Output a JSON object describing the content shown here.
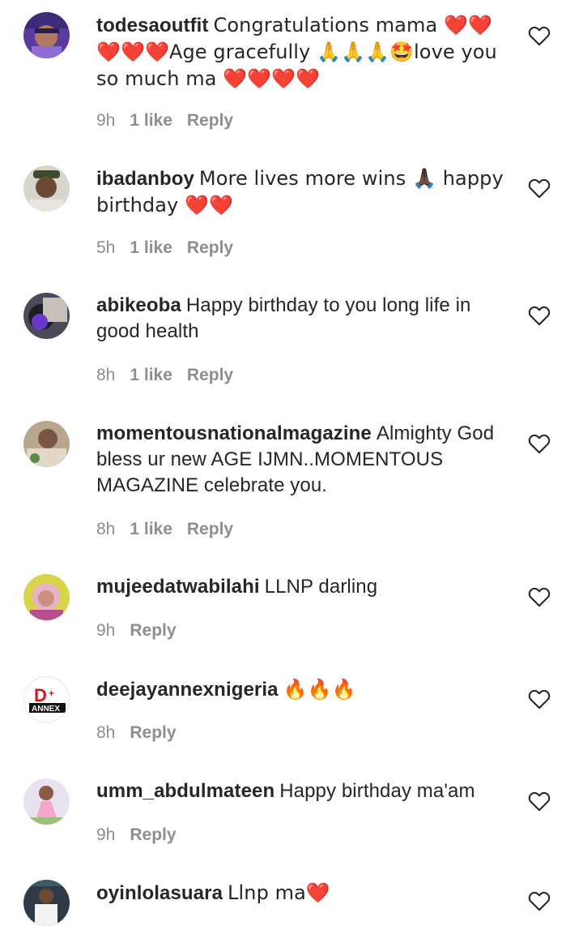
{
  "colors": {
    "text": "#262626",
    "muted": "#8e8e8e",
    "heart": "#e0201e",
    "background": "#ffffff"
  },
  "comments": [
    {
      "username": "todesaoutfit",
      "text": "Congratulations mama ❤️❤️❤️❤️❤️Age gracefully 🙏🙏🙏🤩love you so much ma ❤️❤️❤️❤️",
      "time": "9h",
      "likes": "1 like",
      "reply": "Reply",
      "avatar_icon": "avatar-photo"
    },
    {
      "username": "ibadanboy",
      "text": "More lives more wins 🙏🏿 happy birthday ❤️❤️",
      "time": "5h",
      "likes": "1 like",
      "reply": "Reply",
      "avatar_icon": "avatar-photo"
    },
    {
      "username": "abikeoba",
      "text": "Happy birthday to you long life in good health",
      "time": "8h",
      "likes": "1 like",
      "reply": "Reply",
      "avatar_icon": "avatar-photo"
    },
    {
      "username": "momentousnationalmagazine",
      "text": "Almighty God bless ur new AGE IJMN..MOMENTOUS MAGAZINE celebrate you.",
      "time": "8h",
      "likes": "1 like",
      "reply": "Reply",
      "avatar_icon": "avatar-photo"
    },
    {
      "username": "mujeedatwabilahi",
      "text": "LLNP darling",
      "time": "9h",
      "likes": "",
      "reply": "Reply",
      "avatar_icon": "avatar-photo"
    },
    {
      "username": "deejayannexnigeria",
      "text": "🔥🔥🔥",
      "time": "8h",
      "likes": "",
      "reply": "Reply",
      "avatar_icon": "dj-annex-logo"
    },
    {
      "username": "umm_abdulmateen",
      "text": "Happy birthday ma'am",
      "time": "9h",
      "likes": "",
      "reply": "Reply",
      "avatar_icon": "avatar-photo"
    },
    {
      "username": "oyinlolasuara",
      "text": "Llnp ma❤️",
      "time": "",
      "likes": "",
      "reply": "",
      "avatar_icon": "avatar-photo"
    }
  ],
  "logo_text": "ANNEX"
}
